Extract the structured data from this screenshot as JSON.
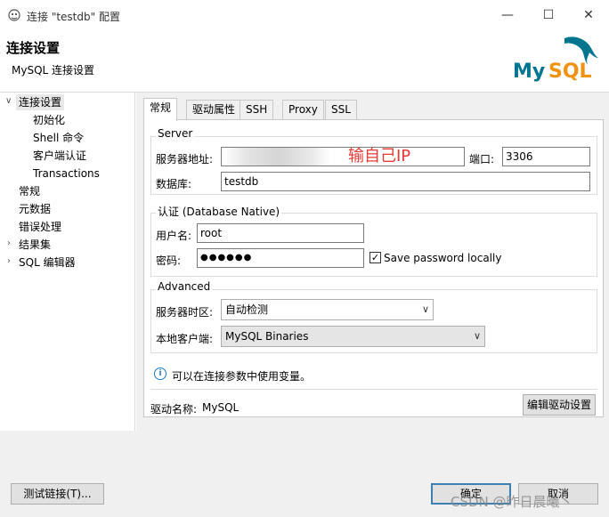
{
  "window": {
    "title": "连接 \"testdb\" 配置",
    "min_icon": "—",
    "max_icon": "☐",
    "close_icon": "✕"
  },
  "header": {
    "title": "连接设置",
    "subtitle": "MySQL 连接设置",
    "logo_text": "MySQL",
    "logo_colors": {
      "my": "#00758f",
      "sql": "#f29111"
    }
  },
  "nav": {
    "items": [
      {
        "label": "连接设置",
        "expanded": true,
        "selected": true
      },
      {
        "label": "初始化"
      },
      {
        "label": "Shell 命令"
      },
      {
        "label": "客户端认证"
      },
      {
        "label": "Transactions"
      },
      {
        "label": "常规"
      },
      {
        "label": "元数据"
      },
      {
        "label": "错误处理"
      },
      {
        "label": "结果集",
        "expandable": true
      },
      {
        "label": "SQL 编辑器",
        "expandable": true
      }
    ]
  },
  "tabs": [
    "常规",
    "驱动属性",
    "SSH",
    "Proxy",
    "SSL"
  ],
  "server": {
    "group_label": "Server",
    "host_label": "服务器地址:",
    "host_value": "",
    "port_label": "端口:",
    "port_value": "3306",
    "db_label": "数据库:",
    "db_value": "testdb",
    "annotation": "输自己IP"
  },
  "auth": {
    "group_label": "认证 (Database Native)",
    "user_label": "用户名:",
    "user_value": "root",
    "pass_label": "密码:",
    "pass_value": "●●●●●●",
    "save_password_label": "Save password locally",
    "save_password_checked": "✓"
  },
  "advanced": {
    "group_label": "Advanced",
    "timezone_label": "服务器时区:",
    "timezone_value": "自动检测",
    "client_label": "本地客户端:",
    "client_value": "MySQL Binaries"
  },
  "info": {
    "text": "可以在连接参数中使用变量。"
  },
  "driver": {
    "label": "驱动名称:",
    "value": "MySQL",
    "edit_button": "编辑驱动设置"
  },
  "footer": {
    "test_button": "测试链接(T)...",
    "ok_button": "确定",
    "cancel_button": "取消"
  },
  "watermark": "CSDN @昨日晨曦丶"
}
